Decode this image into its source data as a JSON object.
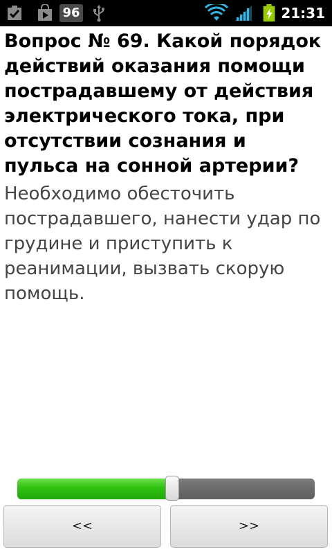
{
  "status_bar": {
    "notification_count": "96",
    "time": "21:31",
    "icons": [
      "checkbox-notification-icon",
      "play-store-icon",
      "usb-icon",
      "wifi-icon",
      "signal-icon",
      "battery-charging-icon"
    ]
  },
  "question": {
    "text": "Вопрос № 69. Какой порядок действий оказания помощи пострадавшему от действия электрического тока, при отсутствии сознания и пульса на сонной артерии?"
  },
  "answer": {
    "text": "Необходимо обесточить пострадавшего, нанести удар по грудине и приступить к реанимации, вызвать скорую помощь."
  },
  "progress": {
    "fraction": 0.52,
    "fill_color": "#2fc012",
    "track_color": "#6a6a6a"
  },
  "navigation": {
    "prev_label": "<<",
    "next_label": ">>"
  }
}
